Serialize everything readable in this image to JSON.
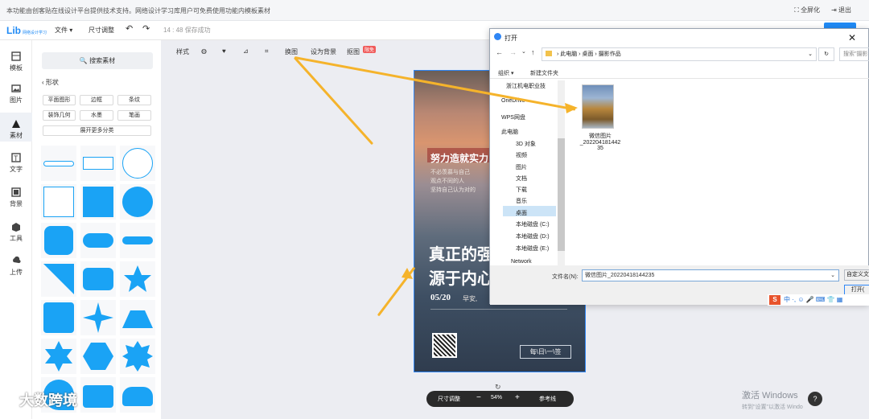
{
  "notice": {
    "text": "本功能由创客贴在线设计平台提供技术支持。网络设计学习库用户可免费使用功能内模板素材",
    "fullscreen": "全屏化",
    "exit": "退出"
  },
  "toolbar": {
    "logo": "Lib",
    "logo_sub": "网络设计学习",
    "file": "文件",
    "resize": "尺寸调整",
    "save_status": "14 : 48 保存成功"
  },
  "rail": [
    {
      "label": "模板",
      "icon": "template-icon"
    },
    {
      "label": "图片",
      "icon": "image-icon"
    },
    {
      "label": "素材",
      "icon": "material-icon"
    },
    {
      "label": "文字",
      "icon": "text-icon"
    },
    {
      "label": "背景",
      "icon": "background-icon"
    },
    {
      "label": "工具",
      "icon": "tool-icon"
    },
    {
      "label": "上传",
      "icon": "upload-icon"
    }
  ],
  "panel": {
    "search": "搜索素材",
    "back": "形状",
    "chips": [
      "平面图形",
      "边框",
      "条纹",
      "装饰几何",
      "水墨",
      "笔画"
    ],
    "expand": "展开更多分类"
  },
  "subbar": {
    "style": "样式",
    "cut": "抠图",
    "crop_label": "换图",
    "set_bg": "设为背景",
    "matting": "抠图",
    "badge": "限免"
  },
  "poster": {
    "headline": "努力造就实力",
    "line1": "不必羡慕与自己",
    "line2": "观点不同的人",
    "line3": "坚持自己认为对的",
    "big1": "真正的强",
    "big2": "源于内心",
    "date": "05/20",
    "greeting": "早安,",
    "stamp": "每\\日\\一\\签"
  },
  "zoombar": {
    "adjust": "尺寸调整",
    "zoom": "54%",
    "guides": "参考线"
  },
  "dialog": {
    "title": "打开",
    "path": [
      "此电脑",
      "桌面",
      "摄影作品"
    ],
    "search_placeholder": "搜索\"摄影",
    "organize": "组织",
    "new_folder": "新建文件夹",
    "tree": [
      "浙江机电职业技",
      "OneDrive",
      "WPS网盘",
      "此电脑",
      "3D 对象",
      "视频",
      "图片",
      "文档",
      "下载",
      "音乐",
      "桌面",
      "本地磁盘 (C:)",
      "本地磁盘 (D:)",
      "本地磁盘 (E:)",
      "Network"
    ],
    "file_name": "微信图片_20220418144235",
    "file_label_line1": "微信图片",
    "file_label_line2": "_202204181442",
    "file_label_line3": "35",
    "filename_label": "文件名(N):",
    "filter": "自定义文",
    "open_btn": "打开("
  },
  "watermark": "大数跨境",
  "activate": {
    "title": "激活 Windows",
    "sub": "转到\"设置\"以激活 Windo"
  },
  "colors": {
    "accent": "#1f8af5",
    "shape": "#1aa3f5",
    "arrow": "#f5b32b"
  }
}
